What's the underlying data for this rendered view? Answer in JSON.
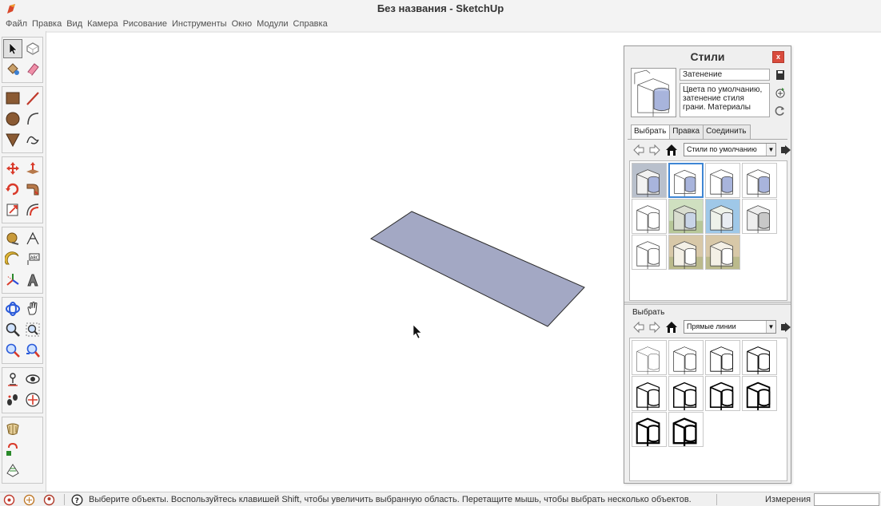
{
  "window": {
    "title": "Без названия - SketchUp"
  },
  "menu": [
    {
      "id": "file",
      "label": "Файл"
    },
    {
      "id": "edit",
      "label": "Правка"
    },
    {
      "id": "view",
      "label": "Вид"
    },
    {
      "id": "camera",
      "label": "Камера"
    },
    {
      "id": "draw",
      "label": "Рисование"
    },
    {
      "id": "tools",
      "label": "Инструменты"
    },
    {
      "id": "window",
      "label": "Окно"
    },
    {
      "id": "plugins",
      "label": "Модули"
    },
    {
      "id": "help",
      "label": "Справка"
    }
  ],
  "toolbar": {
    "groups": [
      [
        "select-icon",
        "component-icon",
        "paint-bucket-icon",
        "eraser-icon"
      ],
      [
        "rectangle-icon",
        "line-icon",
        "circle-icon",
        "arc-icon",
        "polygon-icon",
        "freehand-icon"
      ],
      [
        "move-icon",
        "push-pull-icon",
        "rotate-icon",
        "follow-me-icon",
        "scale-icon",
        "offset-icon"
      ],
      [
        "tape-measure-icon",
        "dimension-icon",
        "protractor-icon",
        "text-icon",
        "axes-icon",
        "3d-text-icon"
      ],
      [
        "orbit-icon",
        "pan-icon",
        "zoom-icon",
        "zoom-window-icon",
        "zoom-extents-icon",
        "previous-view-icon"
      ],
      [
        "position-camera-icon",
        "look-around-icon",
        "walk-icon",
        "section-plane-icon"
      ],
      [
        "sandbox-icon",
        "smoove-icon",
        "from-contours-icon"
      ]
    ]
  },
  "styles_panel": {
    "title": "Стили",
    "close_label": "x",
    "current_style": {
      "name": "Затенение",
      "description": "Цвета по умолчанию,\nзатенение стиля\nграни. Материалы"
    },
    "tabs": [
      {
        "id": "select",
        "label": "Выбрать",
        "selected": true
      },
      {
        "id": "edit",
        "label": "Правка",
        "selected": false
      },
      {
        "id": "mix",
        "label": "Соединить",
        "selected": false
      }
    ],
    "collection": "Стили по умолчанию",
    "thumbs": [
      {
        "name": "style-thumb-shaded-bg",
        "variant": "shaded-bg"
      },
      {
        "name": "style-thumb-shaded",
        "variant": "shaded",
        "selected": true
      },
      {
        "name": "style-thumb-shaded-textures",
        "variant": "shaded"
      },
      {
        "name": "style-thumb-shaded-gray",
        "variant": "shaded"
      },
      {
        "name": "style-thumb-xray",
        "variant": "xray"
      },
      {
        "name": "style-thumb-sketch-green",
        "variant": "green"
      },
      {
        "name": "style-thumb-sketch-sky",
        "variant": "sky"
      },
      {
        "name": "style-thumb-monochrome",
        "variant": "mono"
      },
      {
        "name": "style-thumb-hiddenline",
        "variant": "white"
      },
      {
        "name": "style-thumb-sketchy-beige",
        "variant": "beige"
      },
      {
        "name": "style-thumb-construction",
        "variant": "beige"
      }
    ],
    "secondary": {
      "label": "Выбрать",
      "collection": "Прямые линии",
      "thumbs_count": 10
    }
  },
  "status": {
    "message": "Выберите объекты. Воспользуйтесь клавишей Shift, чтобы увеличить выбранную область. Перетащите мышь, чтобы выбрать несколько объектов.",
    "measurements_label": "Измерения",
    "measurements_value": ""
  },
  "colors": {
    "face": "#a3a8c4",
    "panel_bg": "#efefef",
    "selection": "#3f86d4",
    "close_btn": "#d94b3d"
  }
}
